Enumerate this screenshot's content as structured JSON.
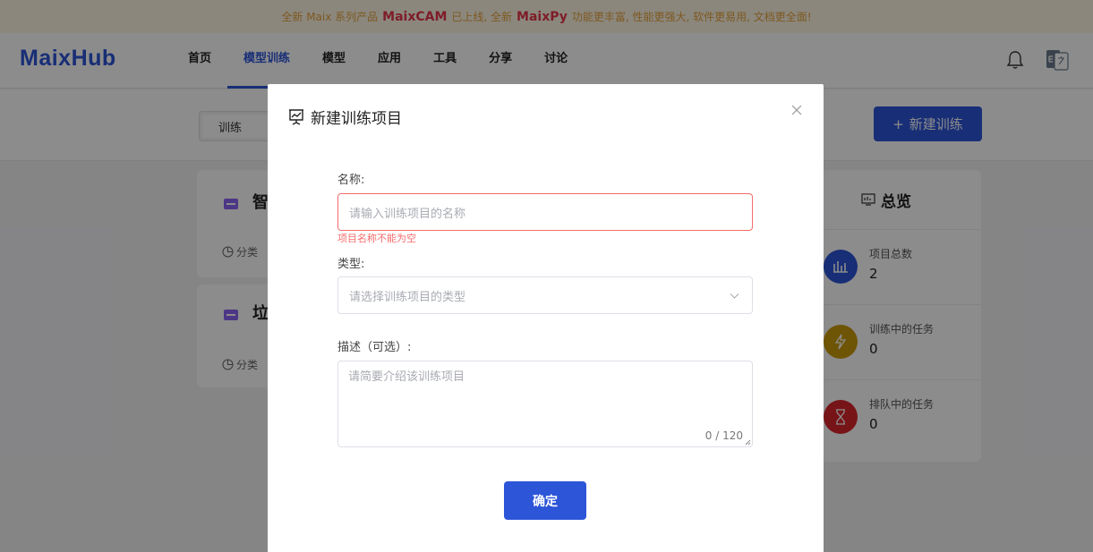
{
  "banner": {
    "prefix": "全新 Maix 系列产品",
    "product1": "MaixCAM",
    "middle": "已上线, 全新",
    "product2": "MaixPy",
    "suffix": "功能更丰富, 性能更强大, 软件更易用, 文档更全面!"
  },
  "header": {
    "logo": "MaixHub",
    "nav": [
      {
        "label": "首页",
        "active": false
      },
      {
        "label": "模型训练",
        "active": true
      },
      {
        "label": "模型",
        "active": false
      },
      {
        "label": "应用",
        "active": false
      },
      {
        "label": "工具",
        "active": false
      },
      {
        "label": "分享",
        "active": false
      },
      {
        "label": "讨论",
        "active": false
      }
    ],
    "icons": [
      "bell-icon",
      "language-switch-icon"
    ]
  },
  "toolbar": {
    "tab_label": "训练",
    "new_button_label": "新建训练"
  },
  "projects": [
    {
      "title": "智",
      "category_label": "分类"
    },
    {
      "title": "垃",
      "category_label": "分类"
    }
  ],
  "overview": {
    "title": "总览",
    "stats": [
      {
        "label": "项目总数",
        "value": "2",
        "color": "#2c55d8",
        "icon": "bar-chart-icon"
      },
      {
        "label": "训练中的任务",
        "value": "0",
        "color": "#c99a0a",
        "icon": "lightning-icon"
      },
      {
        "label": "排队中的任务",
        "value": "0",
        "color": "#d9252b",
        "icon": "hourglass-icon"
      }
    ]
  },
  "dialog": {
    "title": "新建训练项目",
    "name_label": "名称:",
    "name_placeholder": "请输入训练项目的名称",
    "name_error": "项目名称不能为空",
    "type_label": "类型:",
    "type_placeholder": "请选择训练项目的类型",
    "desc_label": "描述（可选）:",
    "desc_placeholder": "请简要介绍该训练项目",
    "desc_counter": "0 / 120",
    "confirm_label": "确定"
  },
  "colors": {
    "primary": "#2c55d8",
    "error": "#f56c6c",
    "banner_bg": "#fdf6e3",
    "banner_text": "#e6a23c",
    "banner_highlight": "#e5364a"
  }
}
